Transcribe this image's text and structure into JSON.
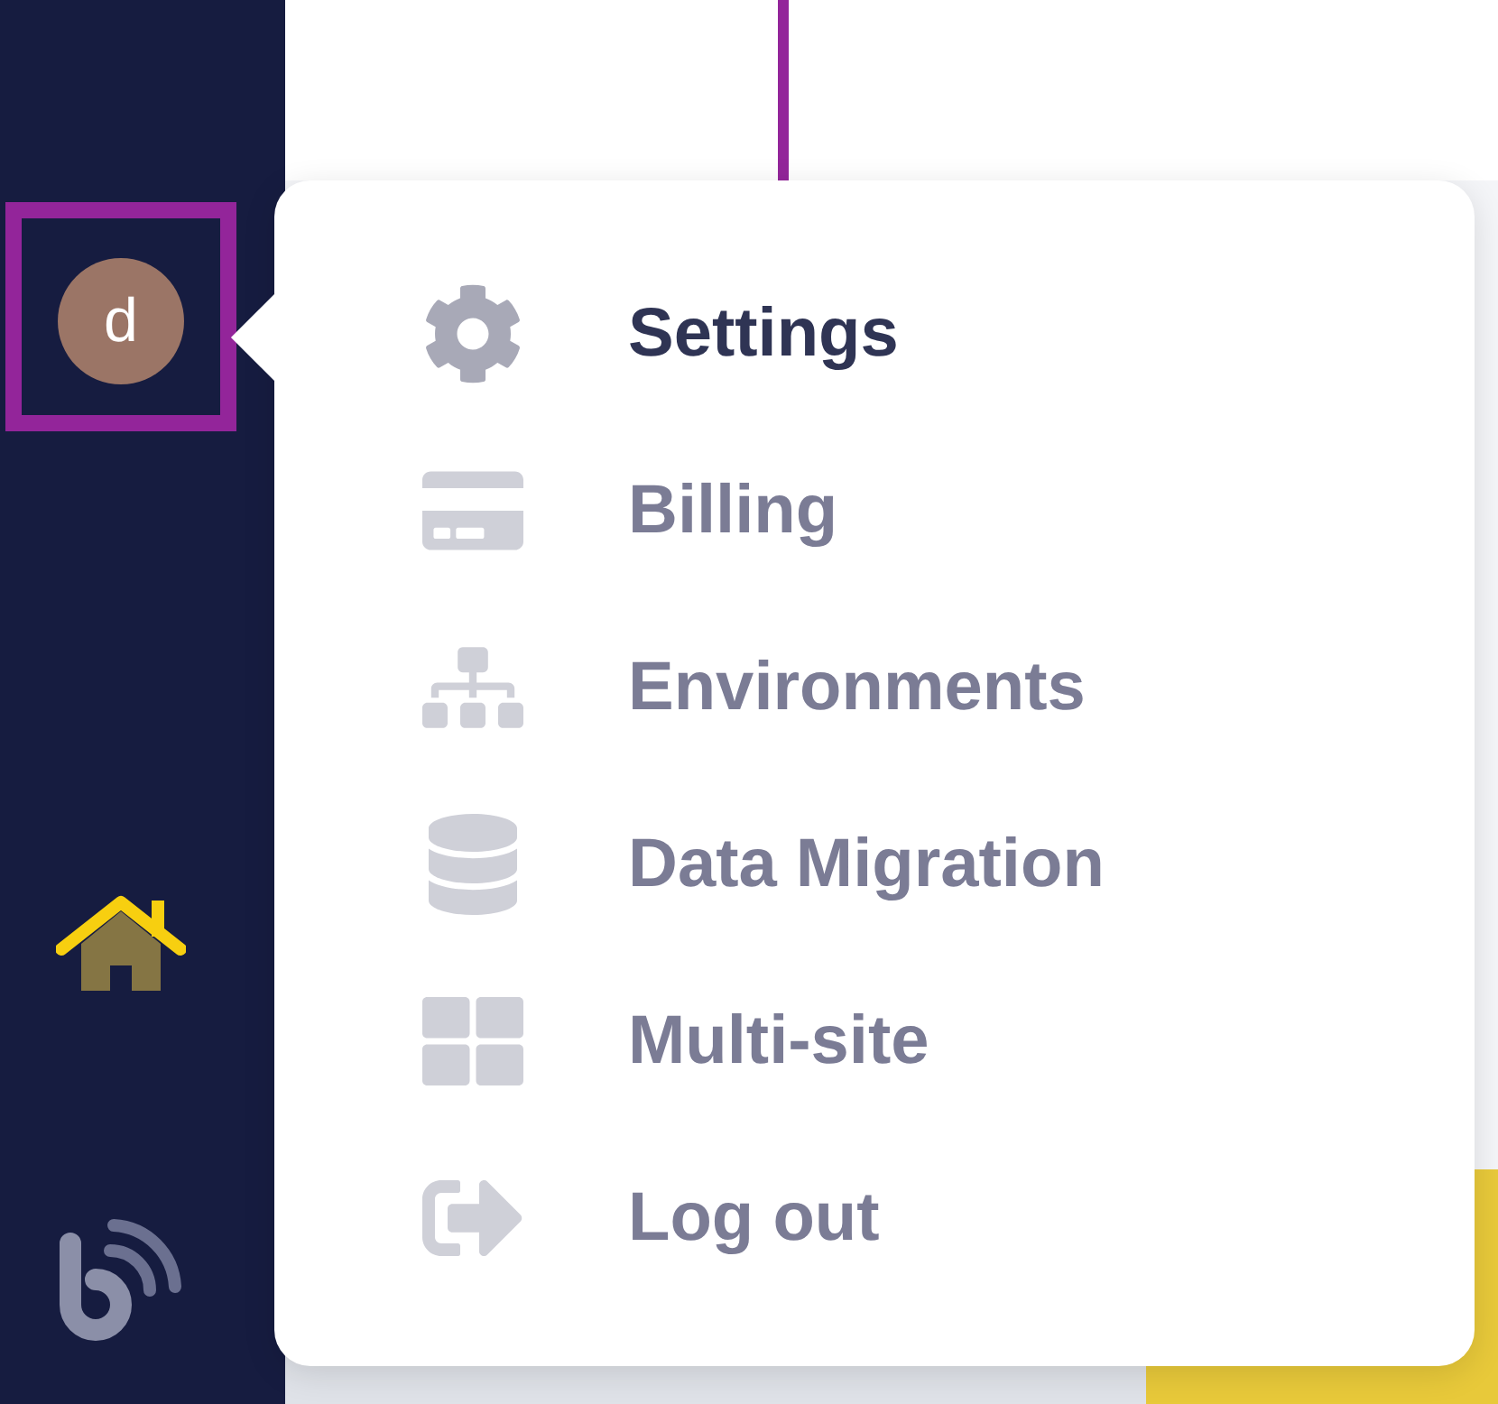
{
  "user": {
    "avatar_initial": "d"
  },
  "nav": [
    {
      "kind": "home",
      "selected": true
    }
  ],
  "menu": {
    "items": [
      {
        "label": "Settings",
        "kind": "settings",
        "selected": true
      },
      {
        "label": "Billing",
        "kind": "billing",
        "selected": false
      },
      {
        "label": "Environments",
        "kind": "environments",
        "selected": false
      },
      {
        "label": "Data Migration",
        "kind": "migration",
        "selected": false
      },
      {
        "label": "Multi-site",
        "kind": "multisite",
        "selected": false
      },
      {
        "label": "Log out",
        "kind": "logout",
        "selected": false
      }
    ]
  }
}
